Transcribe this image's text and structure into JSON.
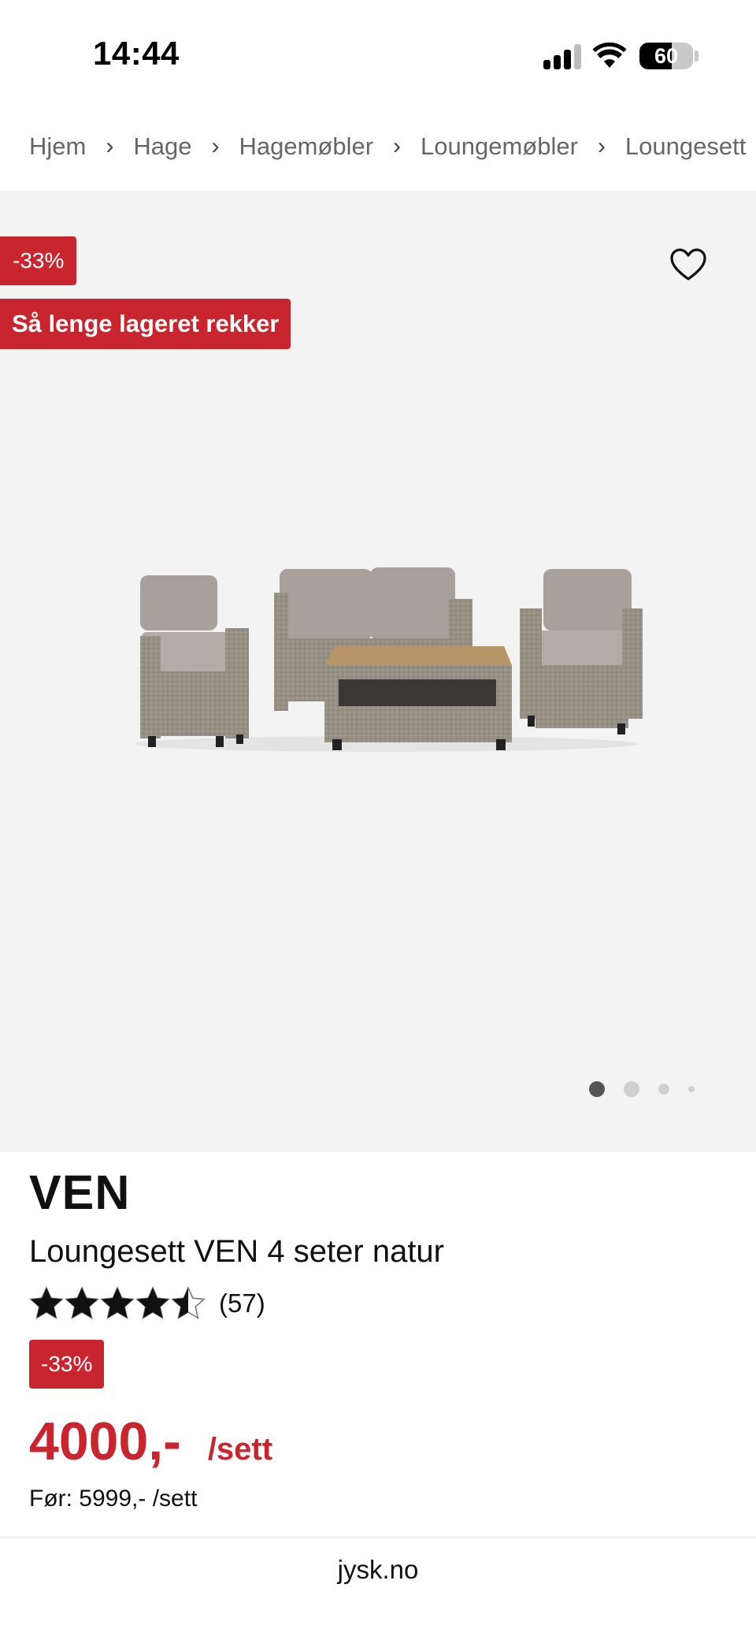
{
  "status_bar": {
    "time": "14:44",
    "battery_level": "60",
    "battery_fraction": 0.6,
    "icons": [
      "signal-icon",
      "wifi-icon",
      "battery-icon"
    ]
  },
  "breadcrumb": [
    "Hjem",
    "Hage",
    "Hagemøbler",
    "Loungemøbler",
    "Loungesett"
  ],
  "gallery": {
    "discount_badge": "-33%",
    "stock_badge": "Så lenge lageret rekker",
    "favorite_icon": "heart-icon",
    "image_count": 4,
    "active_image": 1
  },
  "product": {
    "brand": "VEN",
    "title": "Loungesett VEN 4 seter natur",
    "rating_value": 4.5,
    "rating_max": 5,
    "rating_count": "(57)",
    "discount_badge": "-33%",
    "price": "4000,-",
    "price_unit": "/sett",
    "old_price": "Før: 5999,- /sett"
  },
  "browser": {
    "url": "jysk.no"
  },
  "colors": {
    "brand_red": "#c8252f",
    "gallery_bg": "#f3f3f3",
    "text": "#111111",
    "muted": "#666666"
  }
}
